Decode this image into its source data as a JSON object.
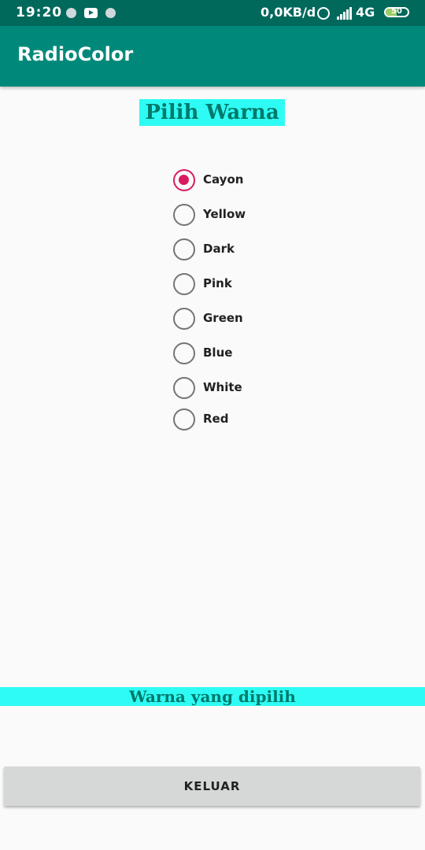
{
  "status_bar": {
    "time": "19:20",
    "network_speed": "0,0KB/d",
    "network_type": "4G",
    "battery_level": "50",
    "battery_fraction": 0.5,
    "icons": [
      "notification-dot-icon",
      "youtube-icon",
      "notification-dot-icon",
      "alarm-icon",
      "signal-icon",
      "battery-icon"
    ]
  },
  "app_bar": {
    "title": "RadioColor"
  },
  "main": {
    "heading": "Pilih Warna",
    "options": [
      {
        "label": "Cayon",
        "checked": true
      },
      {
        "label": "Yellow",
        "checked": false
      },
      {
        "label": "Dark",
        "checked": false
      },
      {
        "label": "Pink",
        "checked": false
      },
      {
        "label": "Green",
        "checked": false
      },
      {
        "label": "Blue",
        "checked": false
      },
      {
        "label": "White",
        "checked": false
      },
      {
        "label": "Red",
        "checked": false
      }
    ],
    "result_label": "Warna yang dipilih",
    "exit_button": "KELUAR"
  },
  "colors": {
    "status_bar": "#00695c",
    "app_bar": "#00897b",
    "highlight": "#2efcf4",
    "highlight_text": "#00796b",
    "radio_checked": "#d81b60",
    "radio_unchecked": "#757575",
    "button_bg": "#d6d7d7",
    "background": "#fafafa"
  }
}
